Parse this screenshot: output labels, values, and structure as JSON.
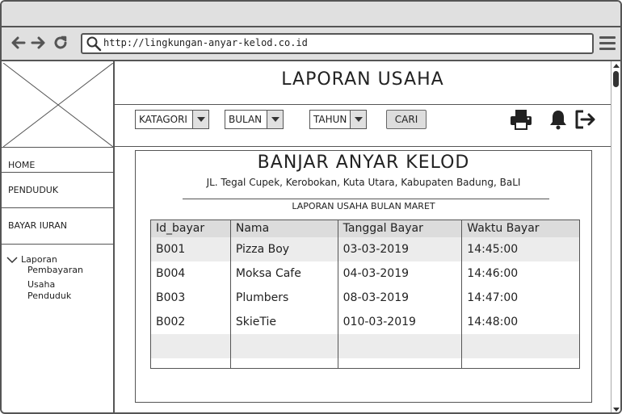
{
  "browser": {
    "url": "http://lingkungan-anyar-kelod.co.id",
    "nav_icons": [
      "back-arrow-icon",
      "forward-arrow-icon",
      "reload-icon",
      "search-icon",
      "hamburger-menu-icon"
    ]
  },
  "sidebar": {
    "items": [
      {
        "label": "HOME"
      },
      {
        "label": "PENDUDUK"
      },
      {
        "label": "BAYAR IURAN"
      }
    ],
    "tree": {
      "label": "Laporan",
      "children": [
        "Pembayaran",
        "Usaha",
        "Penduduk"
      ]
    }
  },
  "header": {
    "title": "LAPORAN USAHA"
  },
  "toolbar": {
    "kategori": "KATAGORI",
    "bulan": "BULAN",
    "tahun": "TAHUN",
    "cari": "CARI",
    "icons": [
      "printer-icon",
      "bell-icon",
      "logout-icon"
    ]
  },
  "report": {
    "title": "BANJAR ANYAR KELOD",
    "address": "JL. Tegal Cupek, Kerobokan, Kuta Utara, Kabupaten Badung, BaLI",
    "subtitle": "LAPORAN USAHA BULAN MARET",
    "columns": [
      "Id_bayar",
      "Nama",
      "Tanggal Bayar",
      "Waktu Bayar"
    ],
    "rows": [
      [
        "B001",
        "Pizza Boy",
        "03-03-2019",
        "14:45:00"
      ],
      [
        "B004",
        "Moksa Cafe",
        "04-03-2019",
        "14:46:00"
      ],
      [
        "B003",
        "Plumbers",
        "08-03-2019",
        "14:47:00"
      ],
      [
        "B002",
        "SkieTie",
        "010-03-2019",
        "14:48:00"
      ]
    ]
  },
  "colors": {
    "chrome_bg": "#e0e0e0",
    "border": "#555555",
    "table_header_bg": "#dcdcdc",
    "row_alt_bg": "#ececec"
  }
}
